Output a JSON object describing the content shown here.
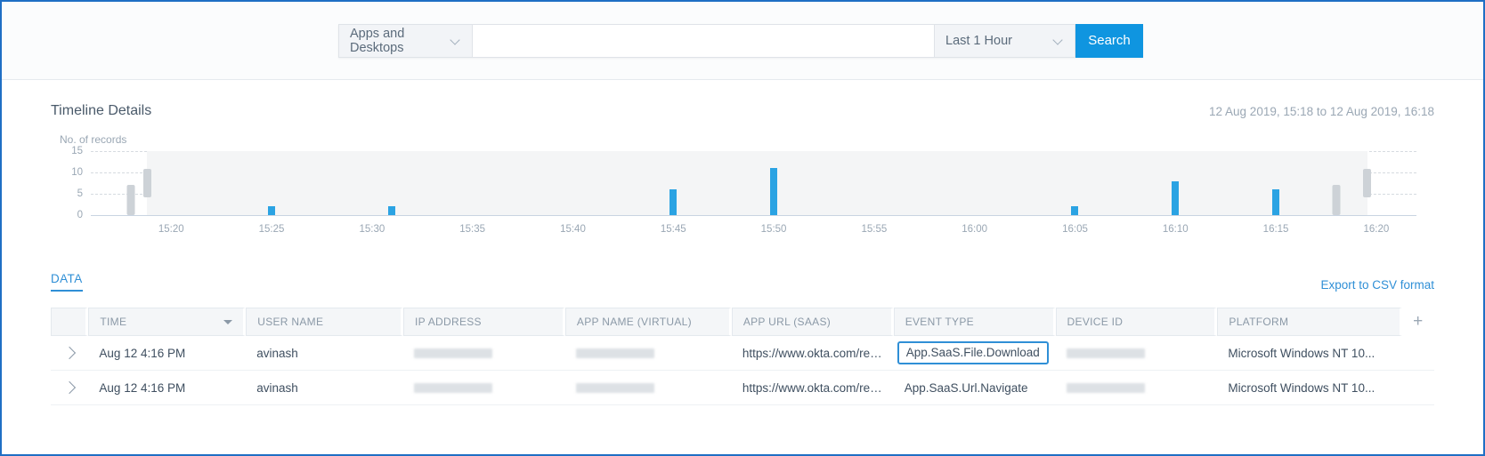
{
  "search": {
    "category_label": "Apps and Desktops",
    "query_value": "",
    "query_placeholder": "",
    "time_range_label": "Last 1 Hour",
    "search_button": "Search"
  },
  "timeline": {
    "title": "Timeline Details",
    "range": "12 Aug 2019, 15:18 to 12 Aug 2019, 16:18"
  },
  "chart_data": {
    "type": "bar",
    "title": "Timeline Details",
    "ylabel": "No. of records",
    "xlabel": "",
    "ylim": [
      0,
      15
    ],
    "yticks": [
      0,
      5,
      10,
      15
    ],
    "grid": true,
    "legend": null,
    "categories": [
      "15:20",
      "15:25",
      "15:30",
      "15:35",
      "15:40",
      "15:45",
      "15:50",
      "15:55",
      "16:00",
      "16:05",
      "16:10",
      "16:15",
      "16:20"
    ],
    "xticks": [
      "15:20",
      "15:25",
      "15:30",
      "15:35",
      "15:40",
      "15:45",
      "15:50",
      "15:55",
      "16:00",
      "16:05",
      "16:10",
      "16:15",
      "16:20"
    ],
    "bars": [
      {
        "time": "15:18",
        "value": 7,
        "color": "#cdd2d7"
      },
      {
        "time": "15:25",
        "value": 2,
        "color": "#2ba3e3"
      },
      {
        "time": "15:31",
        "value": 2,
        "color": "#2ba3e3"
      },
      {
        "time": "15:45",
        "value": 6,
        "color": "#2ba3e3"
      },
      {
        "time": "15:50",
        "value": 11,
        "color": "#2ba3e3"
      },
      {
        "time": "16:05",
        "value": 2,
        "color": "#2ba3e3"
      },
      {
        "time": "16:10",
        "value": 8,
        "color": "#2ba3e3"
      },
      {
        "time": "16:15",
        "value": 6,
        "color": "#2ba3e3"
      },
      {
        "time": "16:18",
        "value": 7,
        "color": "#cdd2d7"
      }
    ],
    "values": [
      0,
      2,
      2,
      0,
      0,
      6,
      11,
      0,
      0,
      2,
      8,
      6,
      0
    ],
    "bar_color": "#2ba3e3",
    "brush_color": "#f4f5f6"
  },
  "table": {
    "tab_label": "DATA",
    "export_label": "Export to CSV format",
    "add_column_icon": "+",
    "columns": [
      {
        "key": "expander",
        "label": ""
      },
      {
        "key": "time",
        "label": "TIME",
        "sortable": true
      },
      {
        "key": "user_name",
        "label": "USER NAME"
      },
      {
        "key": "ip_address",
        "label": "IP ADDRESS"
      },
      {
        "key": "app_name_virtual",
        "label": "APP NAME (VIRTUAL)"
      },
      {
        "key": "app_url_saas",
        "label": "APP URL (SAAS)"
      },
      {
        "key": "event_type",
        "label": "EVENT TYPE"
      },
      {
        "key": "device_id",
        "label": "DEVICE ID"
      },
      {
        "key": "platform",
        "label": "PLATFORM"
      }
    ],
    "rows": [
      {
        "time": "Aug 12 4:16 PM",
        "user_name": "avinash",
        "ip_address": "",
        "app_name_virtual": "",
        "app_url_saas": "https://www.okta.com/res...",
        "event_type": "App.SaaS.File.Download",
        "event_type_highlighted": true,
        "device_id": "",
        "platform": "Microsoft Windows NT 10..."
      },
      {
        "time": "Aug 12 4:16 PM",
        "user_name": "avinash",
        "ip_address": "",
        "app_name_virtual": "",
        "app_url_saas": "https://www.okta.com/res...",
        "event_type": "App.SaaS.Url.Navigate",
        "event_type_highlighted": false,
        "device_id": "",
        "platform": "Microsoft Windows NT 10..."
      }
    ]
  },
  "colors": {
    "accent": "#2f8fd6",
    "button": "#0f95e0",
    "bar": "#2ba3e3",
    "border": "#1f6fc4"
  }
}
